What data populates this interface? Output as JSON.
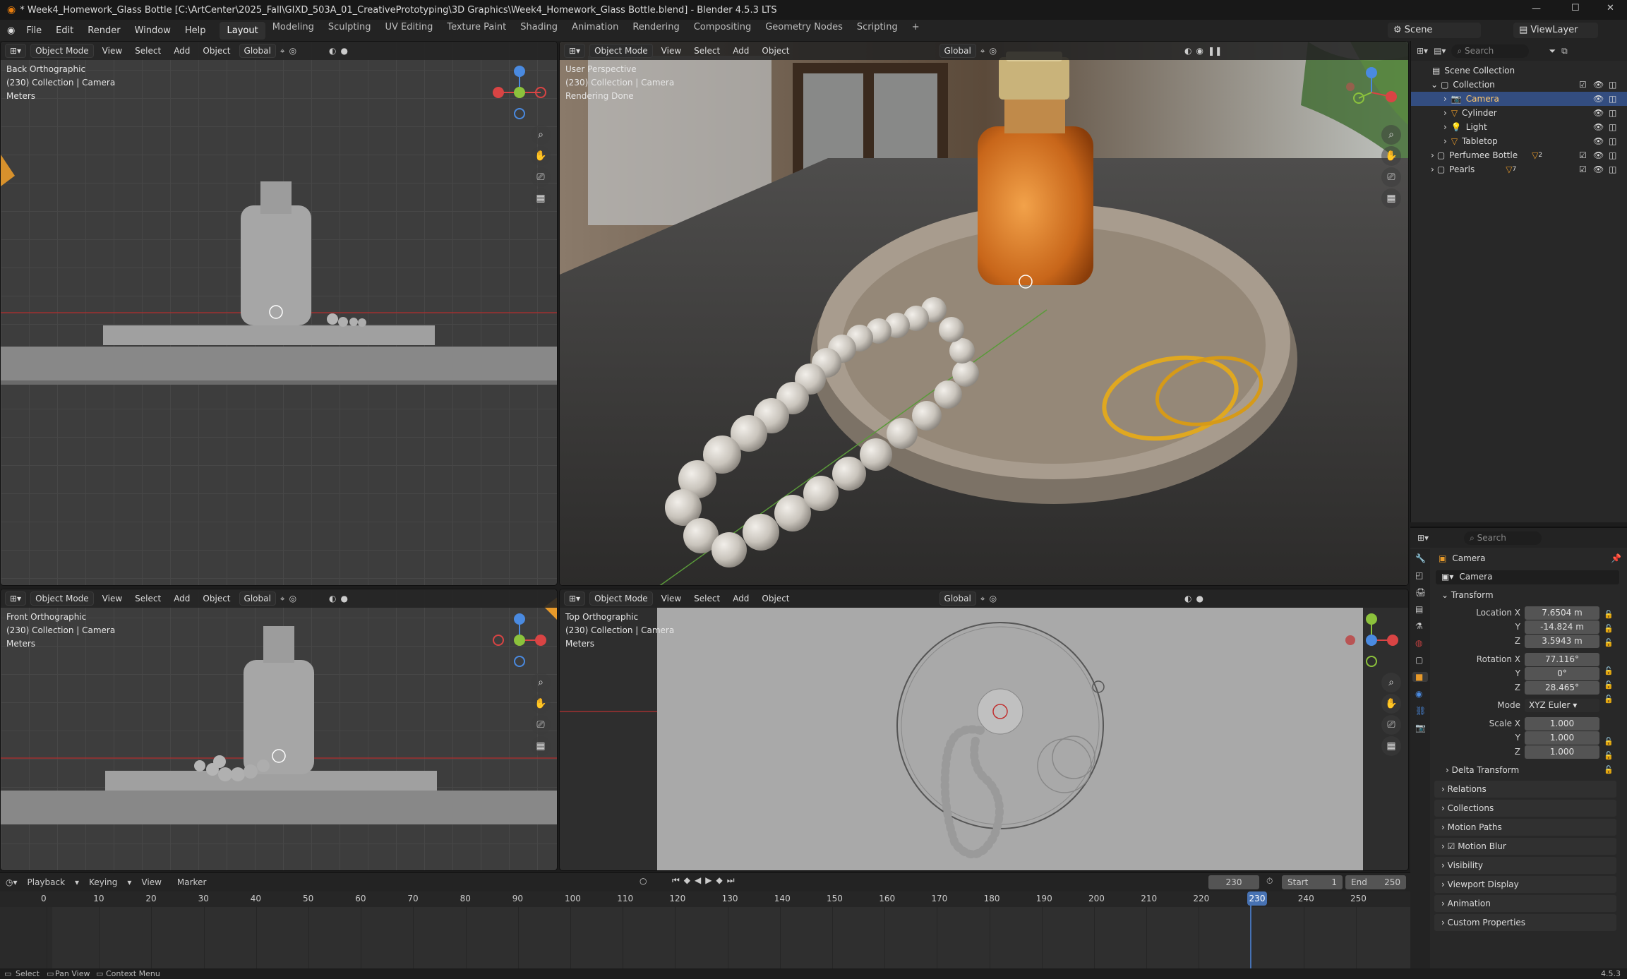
{
  "title": "* Week4_Homework_Glass Bottle [C:\\ArtCenter\\2025_Fall\\GIXD_503A_01_CreativePrototyping\\3D Graphics\\Week4_Homework_Glass Bottle.blend] - Blender 4.5.3 LTS",
  "menus": [
    "File",
    "Edit",
    "Render",
    "Window",
    "Help"
  ],
  "workspaces": [
    "Layout",
    "Modeling",
    "Sculpting",
    "UV Editing",
    "Texture Paint",
    "Shading",
    "Animation",
    "Rendering",
    "Compositing",
    "Geometry Nodes",
    "Scripting"
  ],
  "scene": {
    "scene_label": "Scene",
    "viewlayer_label": "ViewLayer"
  },
  "vp_common": {
    "mode": "Object Mode",
    "view": "View",
    "select": "Select",
    "add": "Add",
    "object": "Object",
    "orient": "Global"
  },
  "vp_tl": {
    "line1": "Back Orthographic",
    "line2": "(230) Collection | Camera",
    "line3": "Meters"
  },
  "vp_tr": {
    "line1": "User Perspective",
    "line2": "(230) Collection | Camera",
    "line3": "Rendering Done"
  },
  "vp_bl": {
    "line1": "Front Orthographic",
    "line2": "(230) Collection | Camera",
    "line3": "Meters"
  },
  "vp_br": {
    "line1": "Top Orthographic",
    "line2": "(230) Collection | Camera",
    "line3": "Meters"
  },
  "outliner": {
    "search": "Search",
    "root": "Scene Collection",
    "collection": "Collection",
    "items": [
      {
        "name": "Camera",
        "selected": true
      },
      {
        "name": "Cylinder",
        "selected": false
      },
      {
        "name": "Light",
        "selected": false
      },
      {
        "name": "Tabletop",
        "selected": false
      }
    ],
    "extra": [
      {
        "name": "Perfumee Bottle",
        "badge": "2"
      },
      {
        "name": "Pearls",
        "badge": "7"
      }
    ]
  },
  "props": {
    "search": "Search",
    "object_name": "Camera",
    "datablock": "Camera",
    "transform": "Transform",
    "loc_label": "Location X",
    "loc_x": "7.6504 m",
    "loc_y": "-14.824 m",
    "loc_z": "3.5943 m",
    "rot_label": "Rotation X",
    "rot_x": "77.116°",
    "rot_y": "0°",
    "rot_z": "28.465°",
    "mode_label": "Mode",
    "mode_val": "XYZ Euler",
    "scale_label": "Scale X",
    "scale_x": "1.000",
    "scale_y": "1.000",
    "scale_z": "1.000",
    "y": "Y",
    "z": "Z",
    "delta": "Delta Transform",
    "panels": [
      "Relations",
      "Collections",
      "Motion Paths",
      "Motion Blur",
      "Visibility",
      "Viewport Display",
      "Animation",
      "Custom Properties"
    ]
  },
  "timeline": {
    "playback": "Playback",
    "keying": "Keying",
    "view": "View",
    "marker": "Marker",
    "current": "230",
    "start_label": "Start",
    "start": "1",
    "end_label": "End",
    "end": "250",
    "ticks": [
      "0",
      "10",
      "20",
      "30",
      "40",
      "50",
      "60",
      "70",
      "80",
      "90",
      "100",
      "110",
      "120",
      "130",
      "140",
      "150",
      "160",
      "170",
      "180",
      "190",
      "200",
      "210",
      "220",
      "230",
      "240",
      "250"
    ]
  },
  "status": {
    "select": "Select",
    "pan": "Pan View",
    "context": "Context Menu",
    "version": "4.5.3"
  }
}
